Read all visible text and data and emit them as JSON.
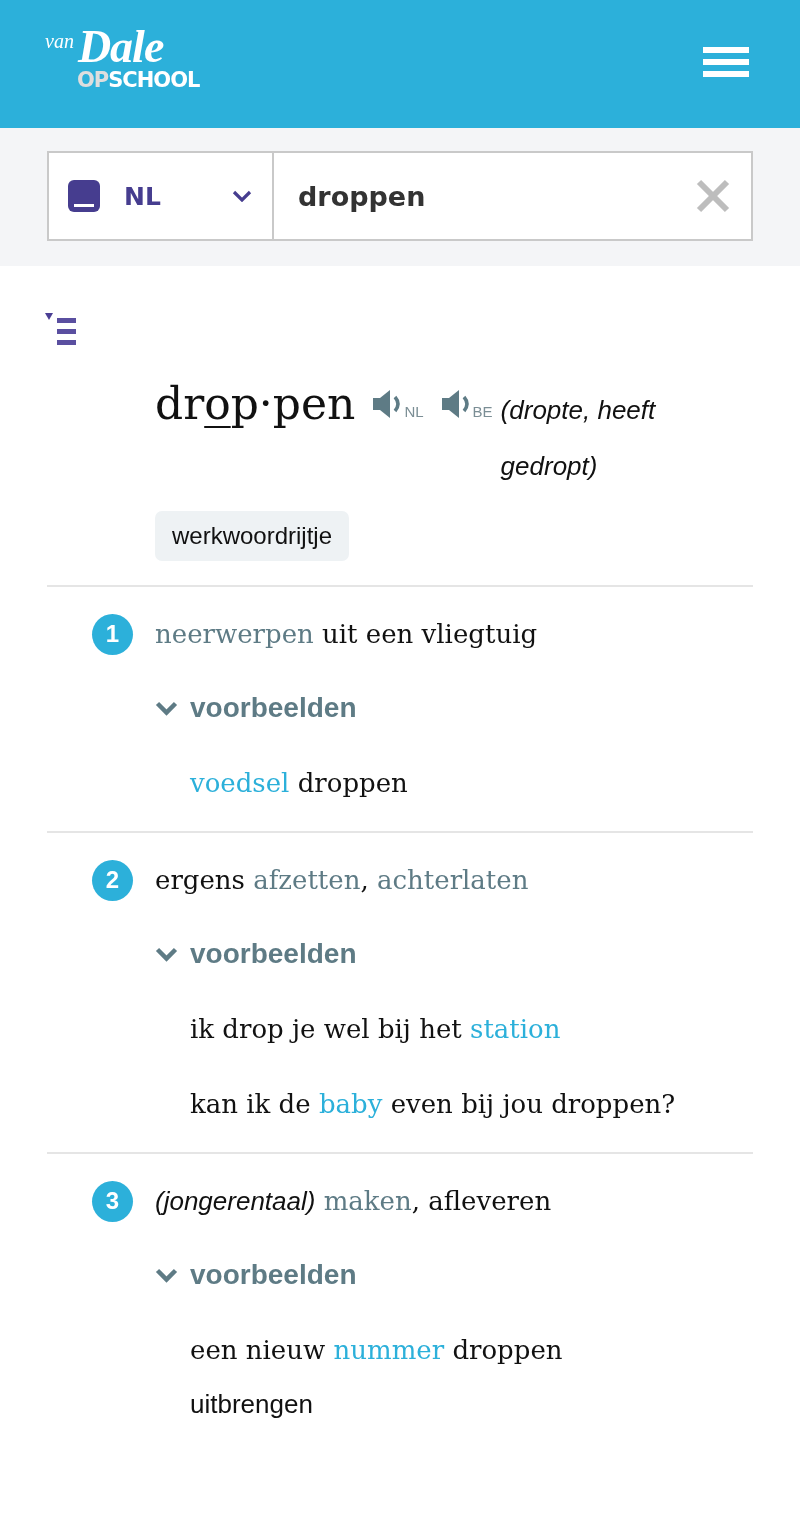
{
  "header": {
    "logo": {
      "words": [
        {
          "text": "van",
          "kind": "small"
        },
        {
          "text": "Dale",
          "kind": "script"
        }
      ],
      "subtitle": [
        {
          "text": "OP",
          "kind": "dim"
        },
        {
          "text": "SCHOOL",
          "kind": "plain"
        }
      ]
    }
  },
  "search": {
    "language": "NL",
    "value": "droppen"
  },
  "entry": {
    "headword": [
      {
        "text": "dr",
        "stressed": false
      },
      {
        "text": "o",
        "stressed": true
      },
      {
        "text": "p·pen",
        "stressed": false
      }
    ],
    "audio": [
      {
        "label": "NL"
      },
      {
        "label": "BE"
      }
    ],
    "forms": "(dropte, heeft gedropt)",
    "tag": "werkwoordrijtje",
    "meanings": [
      {
        "number": "1",
        "definition": [
          {
            "text": "neerwerpen",
            "kind": "link"
          },
          {
            "text": " uit een vliegtuig",
            "kind": "plain"
          }
        ],
        "examples_toggle": {
          "label": "voorbeelden",
          "expanded": true
        },
        "examples": [
          {
            "parts": [
              {
                "text": "voedsel",
                "kind": "link"
              },
              {
                "text": " droppen",
                "kind": "plain"
              }
            ]
          }
        ]
      },
      {
        "number": "2",
        "definition": [
          {
            "text": "ergens ",
            "kind": "plain"
          },
          {
            "text": "afzetten",
            "kind": "link"
          },
          {
            "text": ", ",
            "kind": "plain"
          },
          {
            "text": "achterlaten",
            "kind": "link"
          }
        ],
        "examples_toggle": {
          "label": "voorbeelden",
          "expanded": true
        },
        "examples": [
          {
            "parts": [
              {
                "text": "ik drop je wel bij het ",
                "kind": "plain"
              },
              {
                "text": "station",
                "kind": "link"
              }
            ]
          },
          {
            "parts": [
              {
                "text": "kan ik de ",
                "kind": "plain"
              },
              {
                "text": "baby",
                "kind": "link"
              },
              {
                "text": " even bij jou droppen?",
                "kind": "plain"
              }
            ]
          }
        ]
      },
      {
        "number": "3",
        "register": "(jongerentaal)",
        "definition": [
          {
            "text": "maken",
            "kind": "link"
          },
          {
            "text": ", afleveren",
            "kind": "plain"
          }
        ],
        "examples_toggle": {
          "label": "voorbeelden",
          "expanded": true
        },
        "examples": [
          {
            "parts": [
              {
                "text": "een nieuw ",
                "kind": "plain"
              },
              {
                "text": "nummer",
                "kind": "link"
              },
              {
                "text": " droppen",
                "kind": "plain"
              }
            ],
            "explanation": "uitbrengen"
          }
        ]
      }
    ]
  }
}
